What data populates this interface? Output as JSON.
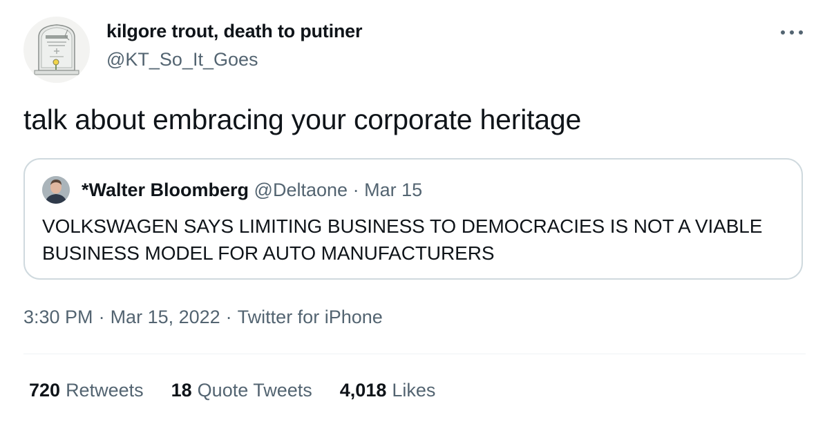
{
  "author": {
    "display_name": "kilgore trout, death to putiner",
    "handle": "@KT_So_It_Goes",
    "avatar_icon": "tombstone-icon"
  },
  "tweet": {
    "text": "talk about embracing your corporate heritage"
  },
  "quote": {
    "display_name": "*Walter Bloomberg",
    "handle": "@Deltaone",
    "date": "Mar 15",
    "separator": "·",
    "text": "VOLKSWAGEN SAYS LIMITING BUSINESS TO DEMOCRACIES IS NOT A VIABLE BUSINESS MODEL FOR AUTO MANUFACTURERS"
  },
  "meta": {
    "time": "3:30 PM",
    "date": "Mar 15, 2022",
    "source": "Twitter for iPhone",
    "separator": "·"
  },
  "stats": {
    "retweets_count": "720",
    "retweets_label": "Retweets",
    "quotes_count": "18",
    "quotes_label": "Quote Tweets",
    "likes_count": "4,018",
    "likes_label": "Likes"
  },
  "colors": {
    "text_primary": "#0f1419",
    "text_secondary": "#536471",
    "border": "#cfd9de"
  }
}
